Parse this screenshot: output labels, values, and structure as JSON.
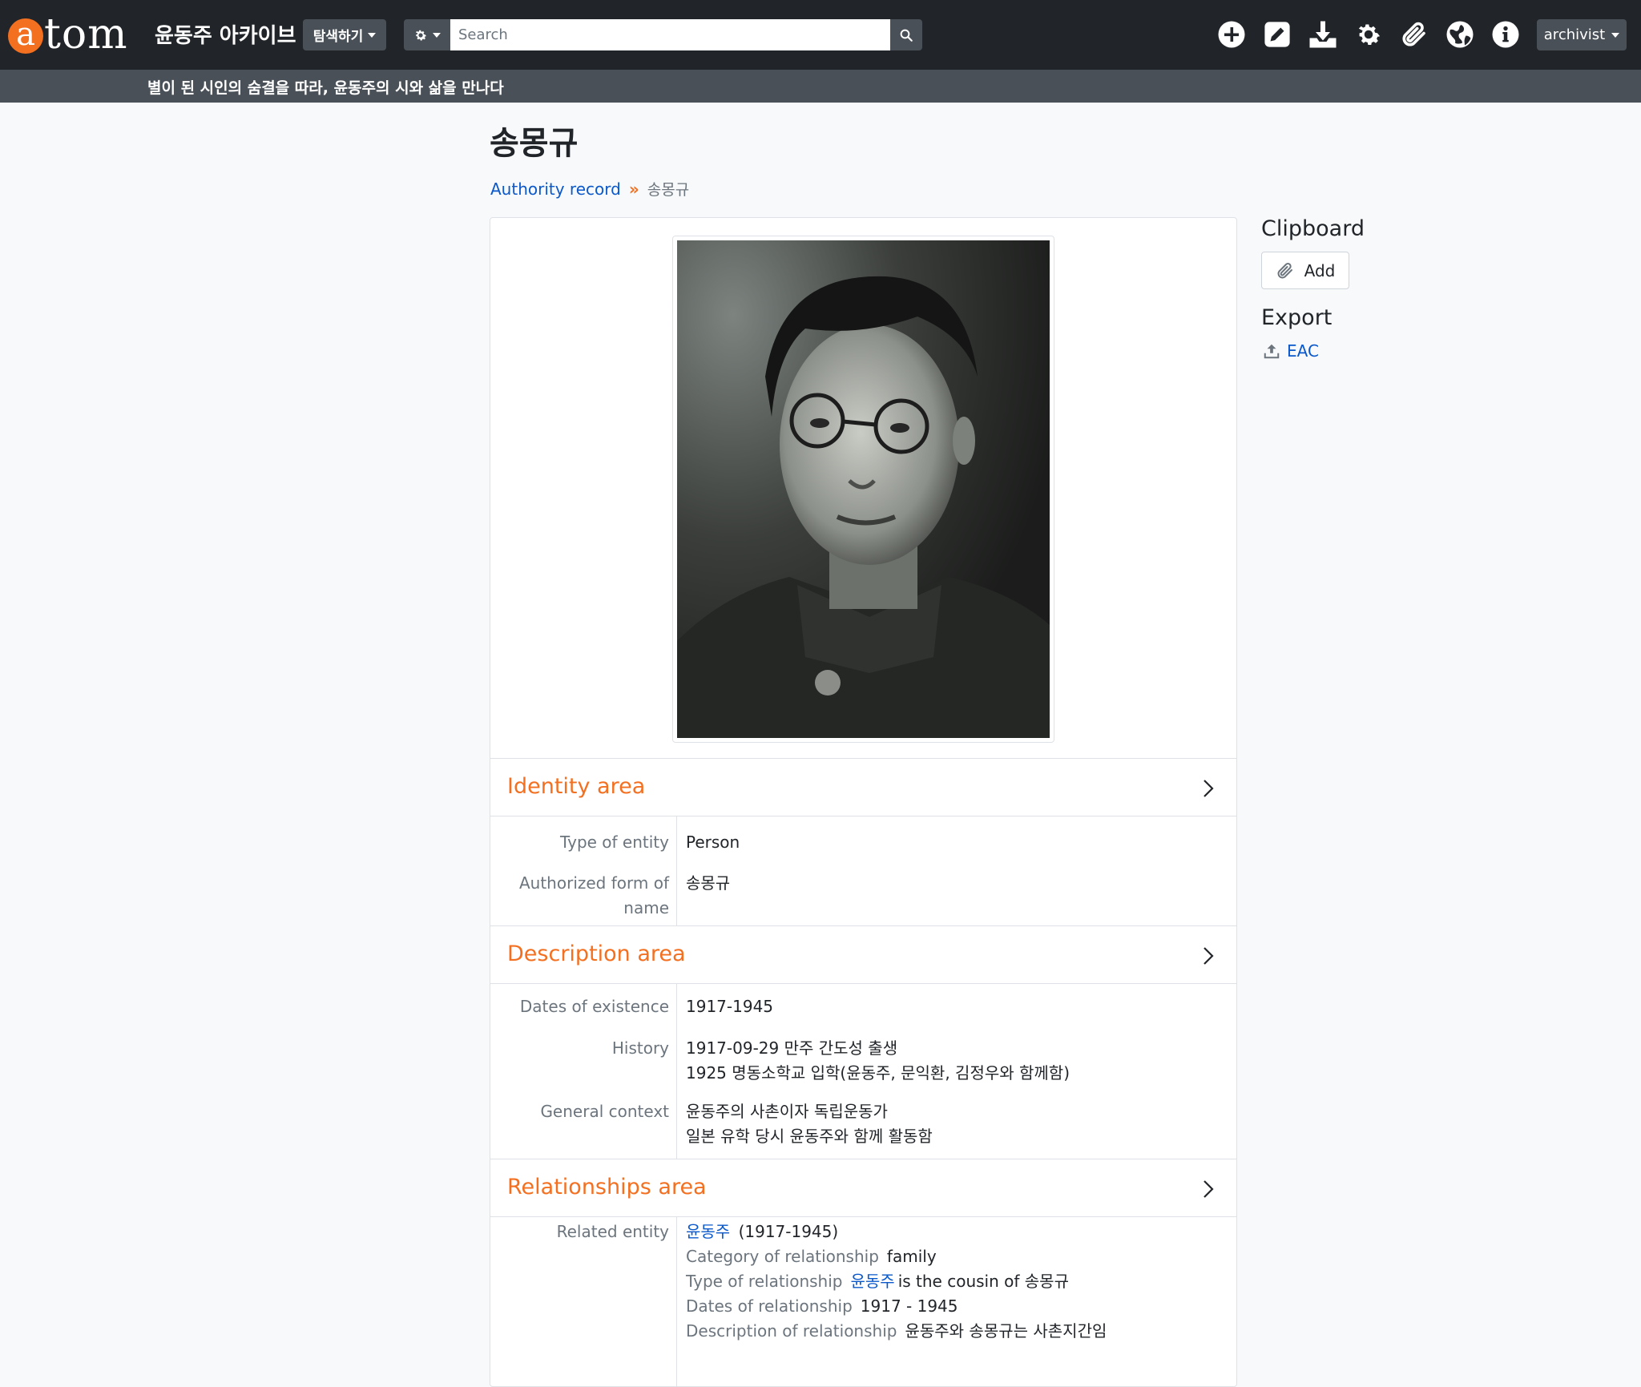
{
  "header": {
    "logo_a": "a",
    "logo_rest": "tom",
    "site_name": "윤동주 아카이브",
    "browse_label": "탐색하기",
    "search_placeholder": "Search",
    "user_label": "archivist",
    "tagline": "별이 된 시인의 숨결을 따라, 윤동주의 시와 삶을 만나다",
    "icons": [
      "plus-circle-icon",
      "edit-icon",
      "download-icon",
      "gear-icon",
      "paperclip-icon",
      "globe-icon",
      "info-icon"
    ]
  },
  "page": {
    "title": "송몽규",
    "breadcrumb": {
      "parent": "Authority record",
      "separator": "»",
      "current": "송몽규"
    }
  },
  "identity": {
    "heading": "Identity area",
    "type_label": "Type of entity",
    "type_value": "Person",
    "name_label_1": "Authorized form of",
    "name_label_2": "name",
    "name_value": "송몽규"
  },
  "description": {
    "heading": "Description area",
    "dates_label": "Dates of existence",
    "dates_value": "1917-1945",
    "history_label": "History",
    "history_line1": "1917-09-29 만주 간도성 출생",
    "history_line2": "1925 명동소학교 입학(윤동주, 문익환, 김정우와 함께함)",
    "context_label": "General context",
    "context_line1": "윤동주의 사촌이자 독립운동가",
    "context_line2": "일본 유학 당시 윤동주와 함께 활동함"
  },
  "relationships": {
    "heading": "Relationships area",
    "related_label": "Related entity",
    "entity_link": "윤동주",
    "entity_dates": "(1917-1945)",
    "category_key": "Category of relationship",
    "category_value": "family",
    "type_key": "Type of relationship",
    "type_link": "윤동주",
    "type_text": "is the cousin of 송몽규",
    "dates_key": "Dates of relationship",
    "dates_value": "1917 - 1945",
    "desc_key": "Description of relationship",
    "desc_value": "윤동주와 송몽규는 사촌지간임"
  },
  "sidebar": {
    "clipboard_heading": "Clipboard",
    "add_label": "Add",
    "export_heading": "Export",
    "eac_label": "EAC"
  },
  "colors": {
    "nav_bg": "#212529",
    "subnav_bg": "#495057",
    "accent": "#f37021",
    "link": "#0a58ca"
  }
}
